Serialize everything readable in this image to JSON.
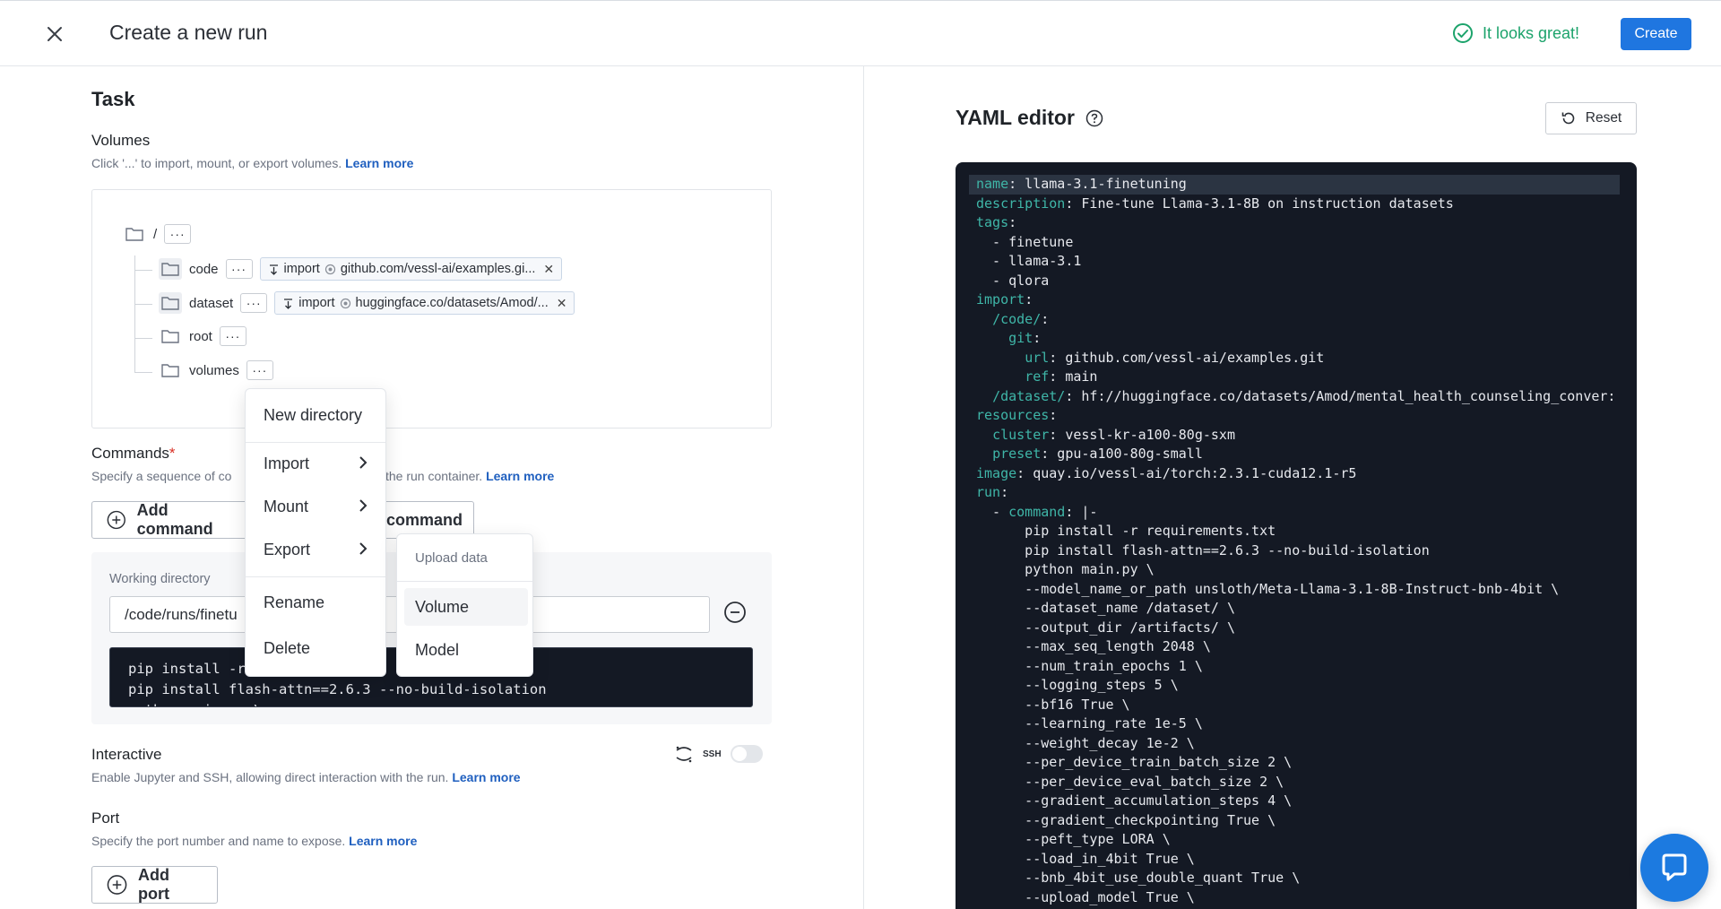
{
  "header": {
    "title": "Create a new run",
    "status": "It looks great!",
    "create_label": "Create"
  },
  "task": {
    "title": "Task",
    "volumes": {
      "title": "Volumes",
      "desc": "Click '...' to import, mount, or export volumes.",
      "learn_more": "Learn more",
      "root_label": "/",
      "items": [
        {
          "name": "code",
          "chip_kind": "import",
          "chip_text": "github.com/vessl-ai/examples.gi..."
        },
        {
          "name": "dataset",
          "chip_kind": "import",
          "chip_text": "huggingface.co/datasets/Amod/..."
        },
        {
          "name": "root"
        },
        {
          "name": "volumes"
        }
      ]
    },
    "commands": {
      "title": "Commands",
      "required_mark": "*",
      "desc_start": "Specify a sequence of co",
      "desc_end": "the run container.",
      "learn_more": "Learn more",
      "add_command": "Add command",
      "add_command_2": "command",
      "workdir_label": "Working directory",
      "workdir_value": "/code/runs/finetu",
      "command_lines": [
        "pip install -r",
        "pip install flash-attn==2.6.3 --no-build-isolation",
        "python main.py \\"
      ]
    },
    "interactive": {
      "title": "Interactive",
      "desc": "Enable Jupyter and SSH, allowing direct interaction with the run.",
      "learn_more": "Learn more",
      "ssh_label": "SSH"
    },
    "port": {
      "title": "Port",
      "desc": "Specify the port number and name to expose.",
      "learn_more": "Learn more",
      "add_port": "Add port"
    }
  },
  "context_menu": {
    "new_directory": "New directory",
    "import": "Import",
    "mount": "Mount",
    "export": "Export",
    "rename": "Rename",
    "delete": "Delete"
  },
  "submenu": {
    "header": "Upload data",
    "items": [
      "Volume",
      "Model"
    ]
  },
  "yaml": {
    "title": "YAML editor",
    "reset_label": "Reset",
    "lines": [
      {
        "k": "name",
        "v": ": llama-3.1-finetuning"
      },
      {
        "k": "description",
        "v": ": Fine-tune Llama-3.1-8B on instruction datasets"
      },
      {
        "k": "tags",
        "v": ":"
      },
      {
        "k": "",
        "v": "  - finetune"
      },
      {
        "k": "",
        "v": "  - llama-3.1"
      },
      {
        "k": "",
        "v": "  - qlora"
      },
      {
        "k": "import",
        "v": ":"
      },
      {
        "p": "  ",
        "k": "/code/",
        "v": ":"
      },
      {
        "p": "    ",
        "k": "git",
        "v": ":"
      },
      {
        "p": "      ",
        "k": "url",
        "v": ": github.com/vessl-ai/examples.git"
      },
      {
        "p": "      ",
        "k": "ref",
        "v": ": main"
      },
      {
        "p": "  ",
        "k": "/dataset/",
        "v": ": hf://huggingface.co/datasets/Amod/mental_health_counseling_conver:"
      },
      {
        "k": "resources",
        "v": ":"
      },
      {
        "p": "  ",
        "k": "cluster",
        "v": ": vessl-kr-a100-80g-sxm"
      },
      {
        "p": "  ",
        "k": "preset",
        "v": ": gpu-a100-80g-small"
      },
      {
        "k": "image",
        "v": ": quay.io/vessl-ai/torch:2.3.1-cuda12.1-r5"
      },
      {
        "k": "run",
        "v": ":"
      },
      {
        "p": "  - ",
        "k": "command",
        "v": ": |-"
      },
      {
        "k": "",
        "v": "      pip install -r requirements.txt"
      },
      {
        "k": "",
        "v": "      pip install flash-attn==2.6.3 --no-build-isolation"
      },
      {
        "k": "",
        "v": "      python main.py \\"
      },
      {
        "k": "",
        "v": "      --model_name_or_path unsloth/Meta-Llama-3.1-8B-Instruct-bnb-4bit \\"
      },
      {
        "k": "",
        "v": "      --dataset_name /dataset/ \\"
      },
      {
        "k": "",
        "v": "      --output_dir /artifacts/ \\"
      },
      {
        "k": "",
        "v": "      --max_seq_length 2048 \\"
      },
      {
        "k": "",
        "v": "      --num_train_epochs 1 \\"
      },
      {
        "k": "",
        "v": "      --logging_steps 5 \\"
      },
      {
        "k": "",
        "v": "      --bf16 True \\"
      },
      {
        "k": "",
        "v": "      --learning_rate 1e-5 \\"
      },
      {
        "k": "",
        "v": "      --weight_decay 1e-2 \\"
      },
      {
        "k": "",
        "v": "      --per_device_train_batch_size 2 \\"
      },
      {
        "k": "",
        "v": "      --per_device_eval_batch_size 2 \\"
      },
      {
        "k": "",
        "v": "      --gradient_accumulation_steps 4 \\"
      },
      {
        "k": "",
        "v": "      --gradient_checkpointing True \\"
      },
      {
        "k": "",
        "v": "      --peft_type LORA \\"
      },
      {
        "k": "",
        "v": "      --load_in_4bit True \\"
      },
      {
        "k": "",
        "v": "      --bnb_4bit_use_double_quant True \\"
      },
      {
        "k": "",
        "v": "      --upload_model True \\"
      }
    ]
  },
  "colors": {
    "accent": "#1f76e0",
    "success": "#1ca36b",
    "editor_bg": "#141924",
    "yaml_key": "#3fb6a8"
  }
}
